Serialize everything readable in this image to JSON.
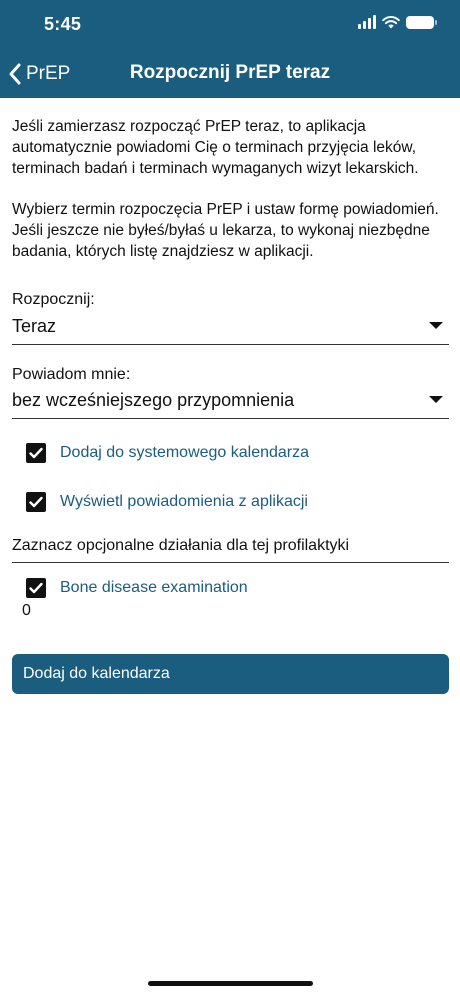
{
  "status_bar": {
    "time": "5:45"
  },
  "nav": {
    "back_label": "PrEP",
    "title": "Rozpocznij PrEP teraz"
  },
  "intro": {
    "paragraph1": "Jeśli zamierzasz rozpocząć PrEP teraz, to aplikacja automatycznie powiadomi Cię o terminach przyjęcia leków, terminach badań i terminach wymaganych wizyt lekarskich.",
    "paragraph2": "Wybierz termin rozpoczęcia PrEP i ustaw formę powiadomień. Jeśli jeszcze nie byłeś/byłaś u lekarza, to wykonaj niezbędne badania, których listę znajdziesz w aplikacji."
  },
  "start": {
    "label": "Rozpocznij:",
    "value": "Teraz"
  },
  "notify": {
    "label": "Powiadom mnie:",
    "value": "bez wcześniejszego przypomnienia"
  },
  "options": [
    {
      "label": "Dodaj do systemowego kalendarza",
      "checked": true
    },
    {
      "label": "Wyświetl powiadomienia z aplikacji",
      "checked": true
    }
  ],
  "optional": {
    "heading": "Zaznacz opcjonalne działania dla tej profilaktyki",
    "items": [
      {
        "label": "Bone disease examination",
        "checked": true
      }
    ],
    "count": "0"
  },
  "primary_button": {
    "label": "Dodaj do kalendarza"
  },
  "colors": {
    "accent": "#1a5d7e",
    "text": "#111111",
    "background": "#ffffff"
  }
}
